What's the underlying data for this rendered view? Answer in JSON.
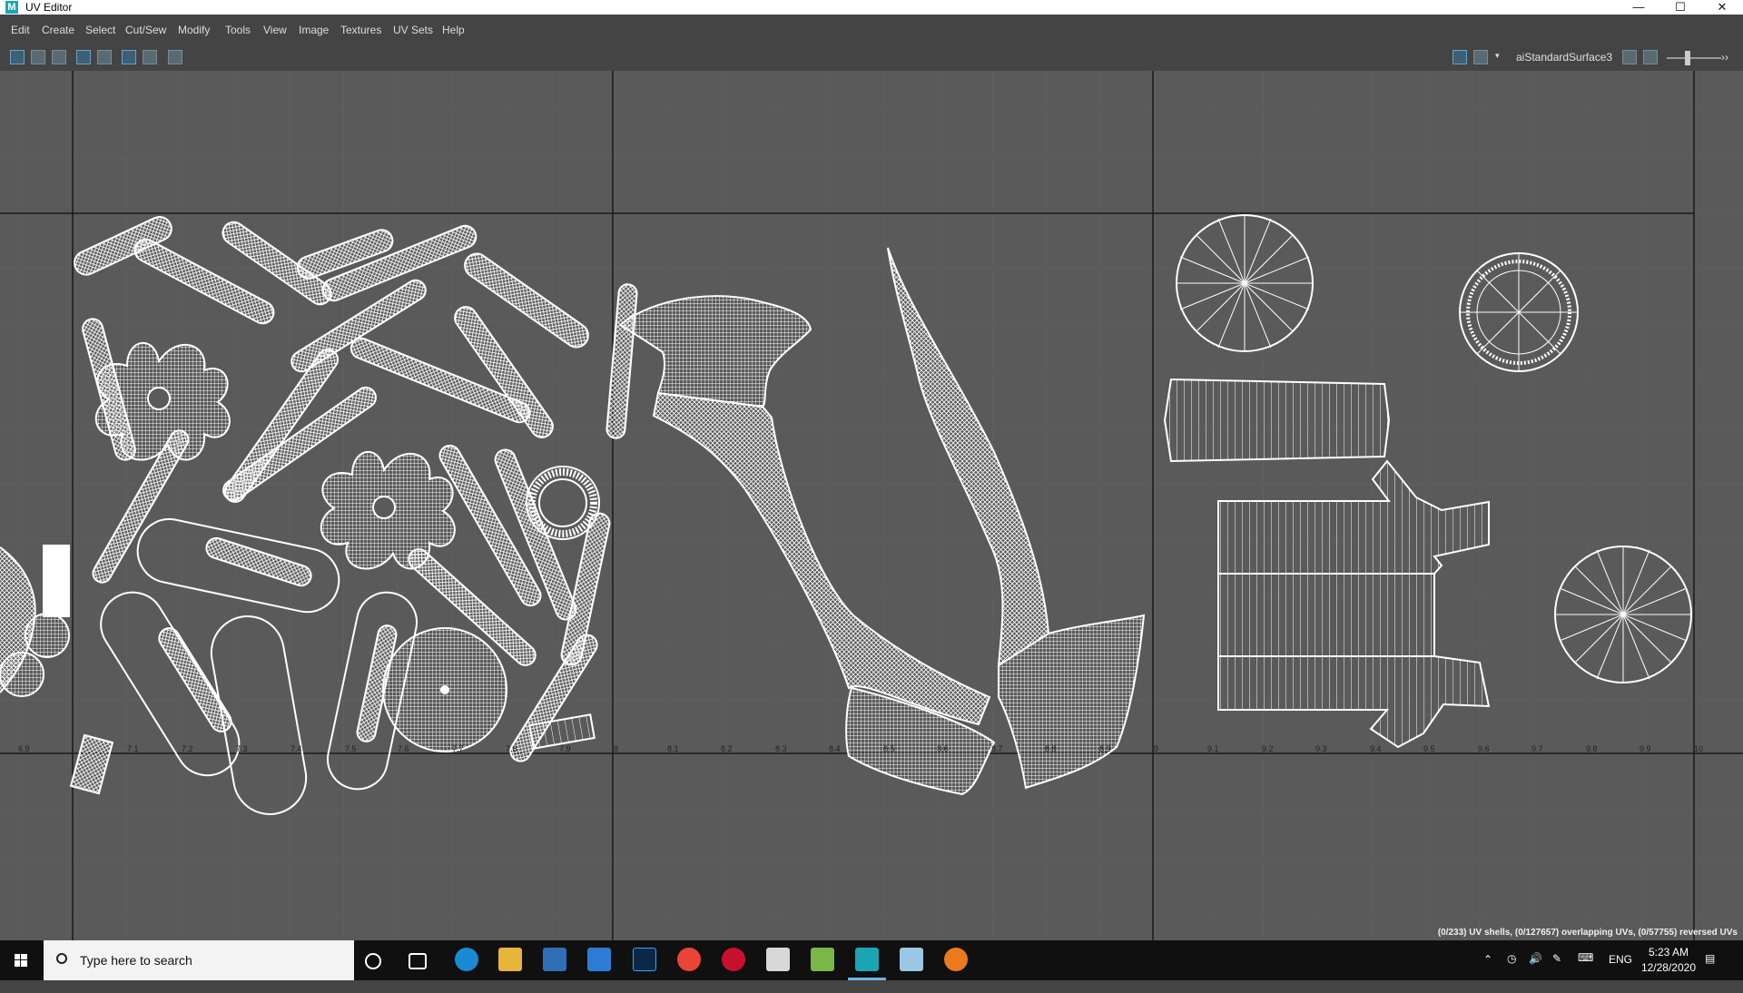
{
  "window": {
    "app_icon": "M",
    "title": "UV Editor"
  },
  "menu": [
    "Edit",
    "Create",
    "Select",
    "Cut/Sew",
    "Modify",
    "Tools",
    "View",
    "Image",
    "Textures",
    "UV Sets",
    "Help"
  ],
  "toolbar": {
    "material": "aiStandardSurface3"
  },
  "axis": {
    "left_ticks": [
      "6.9",
      "7.1",
      "7.2",
      "7.3",
      "7.4",
      "7.5",
      "7.6",
      "7.7",
      "7.8",
      "7.9"
    ],
    "mid_ticks": [
      "8",
      "8.1",
      "8.2",
      "8.3",
      "8.4",
      "8.5",
      "8.6",
      "8.7",
      "8.8",
      "8.9"
    ],
    "right_ticks": [
      "9",
      "9.1",
      "9.2",
      "9.3",
      "9.4",
      "9.5",
      "9.6",
      "9.7",
      "9.8",
      "9.9",
      "10"
    ]
  },
  "status": "(0/233) UV shells, (0/127657) overlapping UVs, (0/57755) reversed UVs",
  "taskbar": {
    "search_placeholder": "Type here to search",
    "lang": "ENG",
    "time": "5:23 AM",
    "date": "12/28/2020"
  },
  "colors": {
    "viewport": "#5a5a5a",
    "uv_wire": "#ffffff",
    "grid_major": "#1a1a1a",
    "grid_minor": "#626262"
  }
}
